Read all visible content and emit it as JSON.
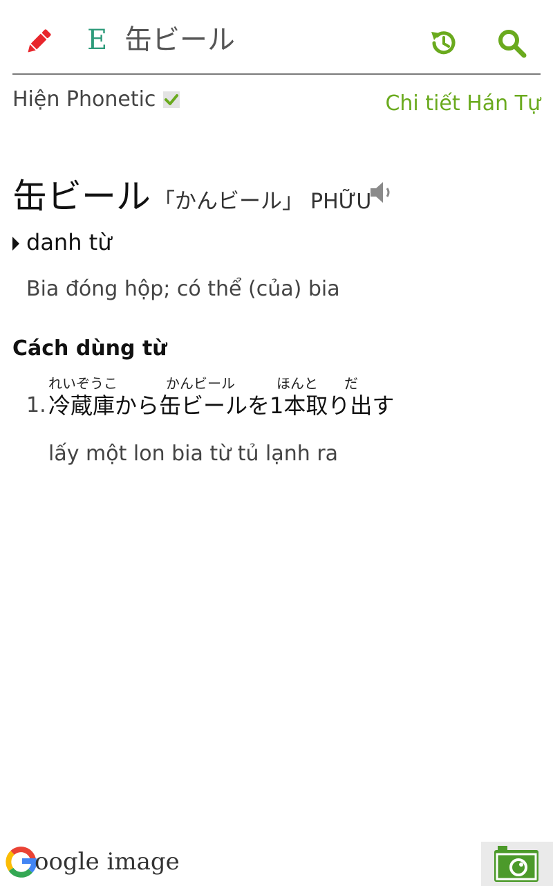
{
  "header": {
    "edit_icon": "pencil-icon",
    "entry_mark": "E",
    "search_term": "缶ビール",
    "history_icon": "history-icon",
    "search_icon": "search-icon"
  },
  "options": {
    "phonetic_label": "Hiện Phonetic",
    "phonetic_checked": true,
    "han_tu_link": "Chi tiết Hán Tự"
  },
  "entry": {
    "headword": "缶ビール",
    "reading": "「かんビール」",
    "hanviet": "PHỮU",
    "part_of_speech": "danh từ",
    "meaning": "Bia đóng hộp; có thể (của) bia"
  },
  "usage": {
    "title": "Cách dùng từ",
    "examples": [
      {
        "number": "1.",
        "furigana": [
          "れいぞうこ",
          "かんビール",
          "ほんと",
          "だ"
        ],
        "japanese": "冷蔵庫から缶ビールを1本取り出す",
        "vietnamese": "lấy một lon bia từ tủ lạnh ra"
      }
    ]
  },
  "footer": {
    "google_text": "oogle image",
    "camera_icon": "camera-icon"
  },
  "colors": {
    "accent_green": "#6aaa1e",
    "pencil_red": "#e8262c",
    "entry_teal": "#2e9b7b"
  }
}
